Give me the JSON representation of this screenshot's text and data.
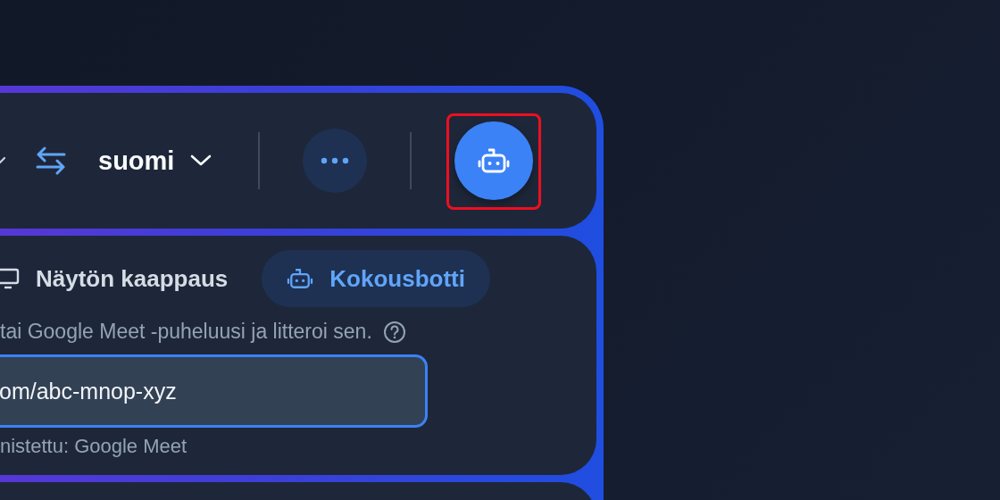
{
  "top_bar": {
    "language": "suomi",
    "bot_button": {
      "highlighted": true
    }
  },
  "source_tabs": [
    {
      "label": "Näytön kaappaus",
      "kind": "screen",
      "selected": false
    },
    {
      "label": "Kokousbotti",
      "kind": "bot",
      "selected": true
    }
  ],
  "hint": "tai Google Meet -puheluusi ja litteroi sen.",
  "meeting_link": {
    "value": "om/abc-mnop-xyz"
  },
  "detected_note": "nistettu: Google Meet"
}
